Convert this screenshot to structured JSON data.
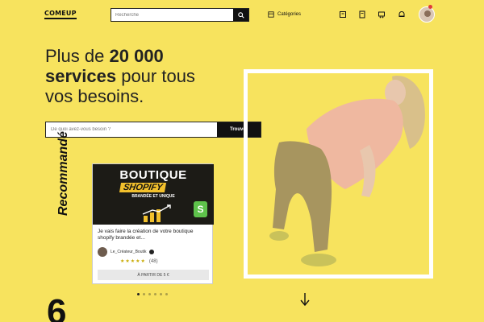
{
  "header": {
    "logo": "COMEUP",
    "search_placeholder": "Recherche",
    "categories_label": "Catégories",
    "icons": [
      "search-icon",
      "grid-icon",
      "heart-icon",
      "document-icon",
      "cart-icon",
      "bell-icon",
      "user-avatar"
    ]
  },
  "hero": {
    "title_line1_prefix": "Plus de ",
    "title_line1_bold": "20 000",
    "title_line2_bold": "services",
    "title_line2_rest": " pour tous",
    "title_line3": "vos besoins.",
    "search_placeholder": "De quoi avez-vous besoin ?",
    "search_button": "Trouver"
  },
  "recommended": {
    "label": "Recommandé",
    "card": {
      "image_title": "BOUTIQUE",
      "image_subtitle": "SHOPIFY",
      "image_tagline": "BRANDÉE ET UNIQUE",
      "shopify_logo": "S",
      "description": "Je vais faire la création de votre boutique shopify brandée et...",
      "seller_name": "Le_Créateur_Boutik",
      "stars": "★★★★★",
      "reviews": "(48)",
      "price_label": "À PARTIR DE 5 €"
    },
    "carousel_dots": 6,
    "active_dot": 1
  },
  "scroll": {
    "arrow": "↓"
  },
  "section_teaser": "6",
  "colors": {
    "background": "#f7e35e",
    "dark": "#111111",
    "accent_yellow": "#f2c02c",
    "shopify_green": "#5ec24b"
  }
}
